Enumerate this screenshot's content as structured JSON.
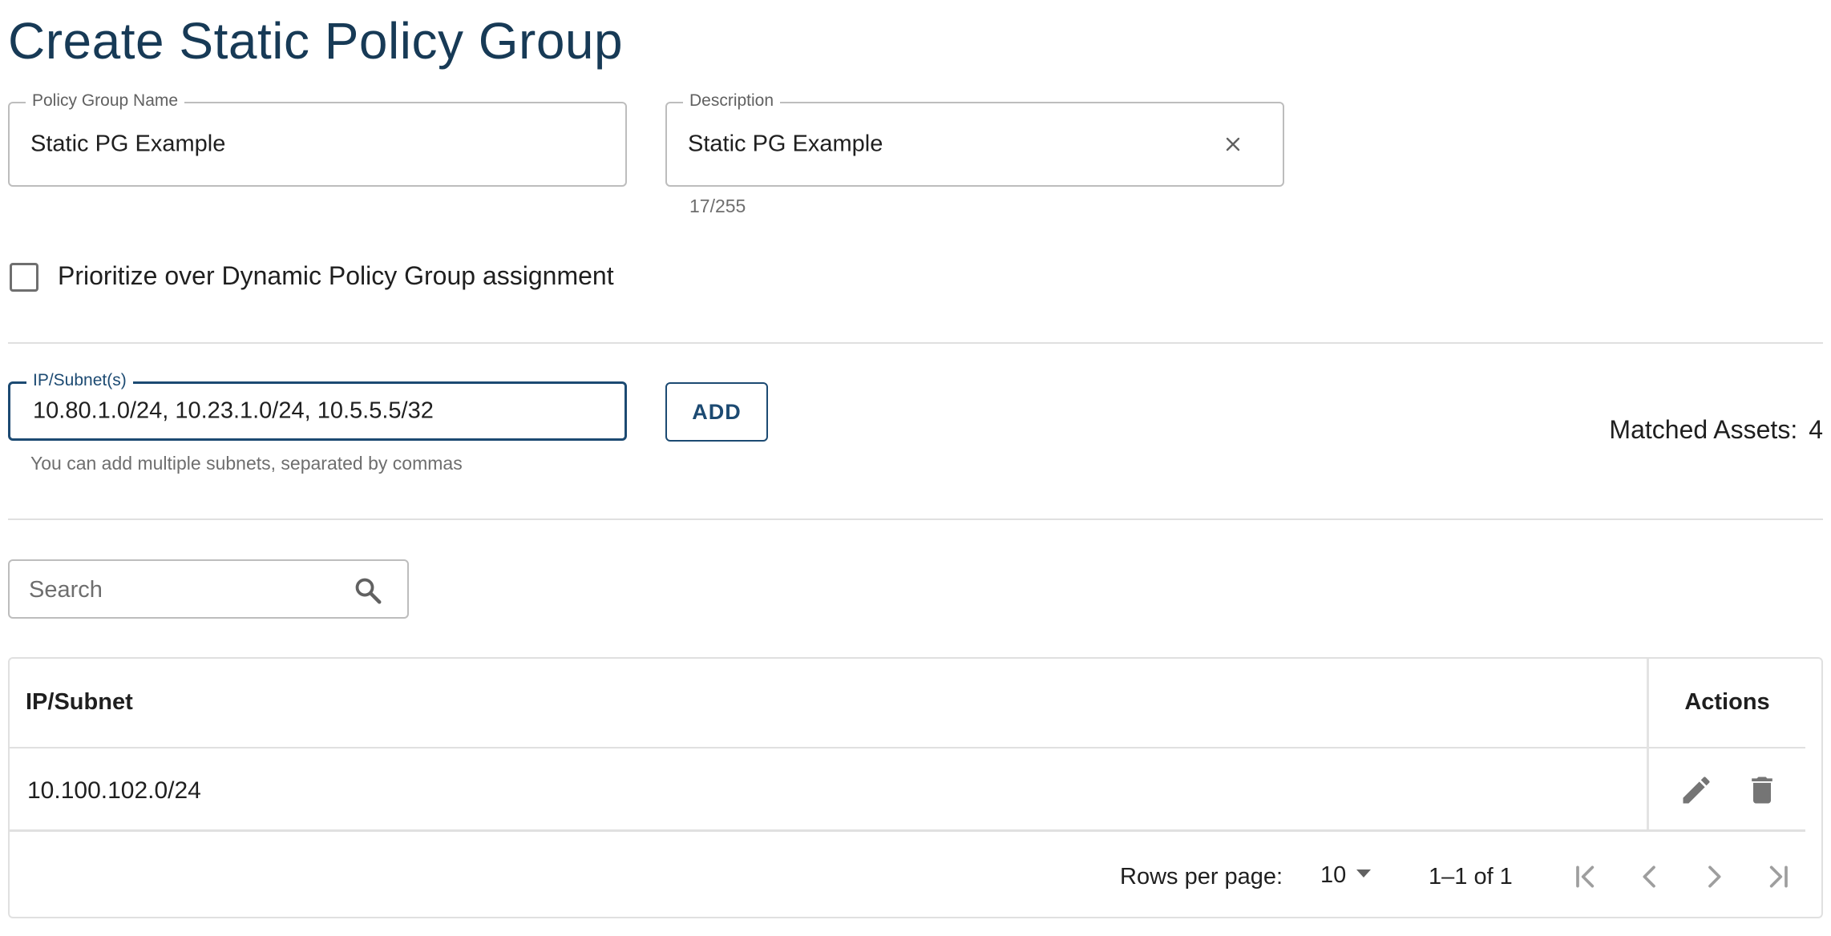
{
  "page": {
    "title": "Create Static Policy Group"
  },
  "form": {
    "name": {
      "label": "Policy Group Name",
      "value": "Static PG Example"
    },
    "description": {
      "label": "Description",
      "value": "Static PG Example",
      "counter": "17/255"
    },
    "prioritize": {
      "label": "Prioritize over Dynamic Policy Group assignment",
      "checked": false
    },
    "subnets": {
      "label": "IP/Subnet(s)",
      "value": "10.80.1.0/24, 10.23.1.0/24, 10.5.5.5/32",
      "helper": "You can add multiple subnets, separated by commas"
    },
    "add_label": "ADD"
  },
  "matched": {
    "label": "Matched Assets:",
    "count": "4"
  },
  "search": {
    "placeholder": "Search"
  },
  "table": {
    "columns": {
      "ip": "IP/Subnet",
      "actions": "Actions"
    },
    "rows": [
      {
        "ip": "10.100.102.0/24"
      }
    ],
    "footer": {
      "rows_per_page_label": "Rows per page:",
      "rows_per_page": "10",
      "range": "1–1 of 1"
    }
  },
  "colors": {
    "primary": "#1c4a72",
    "title": "#173a56",
    "icon": "#757575",
    "border": "#bdbdbd"
  },
  "icons": [
    "clear-icon",
    "search-icon",
    "edit-icon",
    "delete-icon",
    "chevron-down-icon",
    "first-page-icon",
    "previous-page-icon",
    "next-page-icon",
    "last-page-icon"
  ]
}
